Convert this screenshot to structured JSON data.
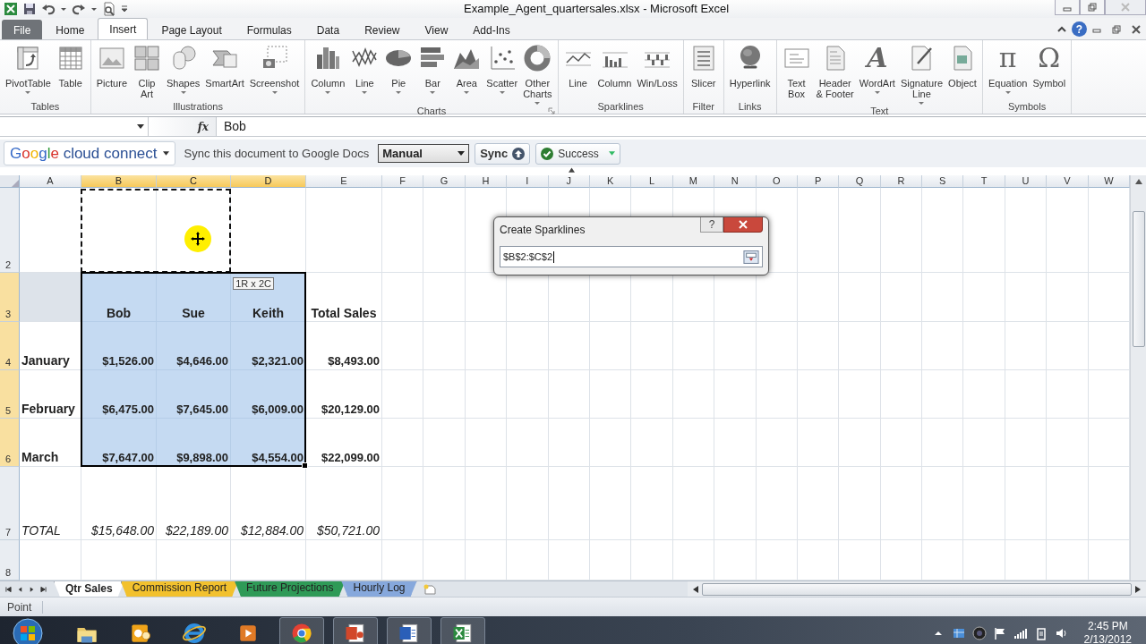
{
  "window": {
    "title": "Example_Agent_quartersales.xlsx - Microsoft Excel"
  },
  "ribbon_tabs": [
    {
      "label": "File",
      "selected": false,
      "kind": "file"
    },
    {
      "label": "Home",
      "selected": false,
      "kind": "tab"
    },
    {
      "label": "Insert",
      "selected": true,
      "kind": "tab"
    },
    {
      "label": "Page Layout",
      "selected": false,
      "kind": "tab"
    },
    {
      "label": "Formulas",
      "selected": false,
      "kind": "tab"
    },
    {
      "label": "Data",
      "selected": false,
      "kind": "tab"
    },
    {
      "label": "Review",
      "selected": false,
      "kind": "tab"
    },
    {
      "label": "View",
      "selected": false,
      "kind": "tab"
    },
    {
      "label": "Add-Ins",
      "selected": false,
      "kind": "tab"
    }
  ],
  "help": "?",
  "ribbon_groups": [
    {
      "label": "Tables",
      "items": [
        {
          "label": "PivotTable",
          "kind": "pivot",
          "dropdown": true
        },
        {
          "label": "Table",
          "kind": "table",
          "dropdown": false
        }
      ]
    },
    {
      "label": "Illustrations",
      "items": [
        {
          "label": "Picture",
          "kind": "picture",
          "dropdown": false
        },
        {
          "label": "Clip\nArt",
          "kind": "clipart",
          "dropdown": false
        },
        {
          "label": "Shapes",
          "kind": "shapes",
          "dropdown": true
        },
        {
          "label": "SmartArt",
          "kind": "smartart",
          "dropdown": false
        },
        {
          "label": "Screenshot",
          "kind": "screenshot",
          "dropdown": true
        }
      ]
    },
    {
      "label": "Charts",
      "launcher": true,
      "items": [
        {
          "label": "Column",
          "kind": "column",
          "dropdown": true
        },
        {
          "label": "Line",
          "kind": "line",
          "dropdown": true
        },
        {
          "label": "Pie",
          "kind": "pie",
          "dropdown": true
        },
        {
          "label": "Bar",
          "kind": "bar",
          "dropdown": true
        },
        {
          "label": "Area",
          "kind": "area",
          "dropdown": true
        },
        {
          "label": "Scatter",
          "kind": "scatter",
          "dropdown": true
        },
        {
          "label": "Other\nCharts",
          "kind": "other",
          "dropdown": true
        }
      ]
    },
    {
      "label": "Sparklines",
      "items": [
        {
          "label": "Line",
          "kind": "spark_line",
          "dropdown": false
        },
        {
          "label": "Column",
          "kind": "spark_column",
          "dropdown": false
        },
        {
          "label": "Win/Loss",
          "kind": "winloss",
          "dropdown": false
        }
      ]
    },
    {
      "label": "Filter",
      "items": [
        {
          "label": "Slicer",
          "kind": "slicer",
          "dropdown": false
        }
      ]
    },
    {
      "label": "Links",
      "items": [
        {
          "label": "Hyperlink",
          "kind": "hyperlink",
          "dropdown": false
        }
      ]
    },
    {
      "label": "Text",
      "items": [
        {
          "label": "Text\nBox",
          "kind": "textbox",
          "dropdown": false
        },
        {
          "label": "Header\n& Footer",
          "kind": "header",
          "dropdown": false
        },
        {
          "label": "WordArt",
          "kind": "wordart",
          "glyph": "A",
          "dropdown": true
        },
        {
          "label": "Signature\nLine",
          "kind": "signature",
          "dropdown": true
        },
        {
          "label": "Object",
          "kind": "object",
          "dropdown": false
        }
      ]
    },
    {
      "label": "Symbols",
      "items": [
        {
          "label": "Equation",
          "kind": "equation",
          "glyph": "π",
          "dropdown": true
        },
        {
          "label": "Symbol",
          "kind": "symbol",
          "glyph": "Ω",
          "dropdown": false
        }
      ]
    }
  ],
  "formula_bar": {
    "fx": "fx",
    "value": "Bob"
  },
  "google_bar": {
    "brand": "Google",
    "product": "cloud connect",
    "message": "Sync this document to Google Docs",
    "mode": "Manual",
    "sync_button": "Sync",
    "status": "Success"
  },
  "columns": [
    {
      "label": "A",
      "selected": false
    },
    {
      "label": "B",
      "selected": true
    },
    {
      "label": "C",
      "selected": true
    },
    {
      "label": "D",
      "selected": true
    },
    {
      "label": "E",
      "selected": false
    },
    {
      "label": "F",
      "selected": false
    },
    {
      "label": "G",
      "selected": false
    },
    {
      "label": "H",
      "selected": false
    },
    {
      "label": "I",
      "selected": false
    },
    {
      "label": "J",
      "selected": false
    },
    {
      "label": "K",
      "selected": false
    },
    {
      "label": "L",
      "selected": false
    },
    {
      "label": "M",
      "selected": false
    },
    {
      "label": "N",
      "selected": false
    },
    {
      "label": "O",
      "selected": false
    },
    {
      "label": "P",
      "selected": false
    },
    {
      "label": "Q",
      "selected": false
    },
    {
      "label": "R",
      "selected": false
    },
    {
      "label": "S",
      "selected": false
    },
    {
      "label": "T",
      "selected": false
    },
    {
      "label": "U",
      "selected": false
    },
    {
      "label": "V",
      "selected": false
    },
    {
      "label": "W",
      "selected": false
    }
  ],
  "rows": [
    {
      "number": "2",
      "selected": false,
      "kind": "blank",
      "cells": [
        {
          "selected": false,
          "marquee": false
        },
        {
          "selected": false,
          "marquee": true
        },
        {
          "selected": false,
          "marquee": true
        },
        {
          "selected": false,
          "marquee": false
        },
        {
          "selected": false,
          "marquee": false
        }
      ]
    },
    {
      "number": "3",
      "selected": true,
      "kind": "header",
      "cells": [
        {
          "selected": false,
          "marquee": false
        },
        {
          "text": "Bob",
          "selected": true,
          "marquee": false
        },
        {
          "text": "Sue",
          "selected": true,
          "marquee": false
        },
        {
          "text": "Keith",
          "selected": true,
          "marquee": false
        },
        {
          "text": "Total Sales",
          "selected": false,
          "marquee": false
        }
      ]
    },
    {
      "number": "4",
      "selected": true,
      "kind": "data",
      "cells": [
        {
          "text": "January",
          "selected": false,
          "marquee": false
        },
        {
          "text": "$1,526.00",
          "selected": true,
          "marquee": false
        },
        {
          "text": "$4,646.00",
          "selected": true,
          "marquee": false
        },
        {
          "text": "$2,321.00",
          "selected": true,
          "marquee": false
        },
        {
          "text": "$8,493.00",
          "selected": false,
          "marquee": false
        }
      ]
    },
    {
      "number": "5",
      "selected": true,
      "kind": "data",
      "cells": [
        {
          "text": "February",
          "selected": false,
          "marquee": false
        },
        {
          "text": "$6,475.00",
          "selected": true,
          "marquee": false
        },
        {
          "text": "$7,645.00",
          "selected": true,
          "marquee": false
        },
        {
          "text": "$6,009.00",
          "selected": true,
          "marquee": false
        },
        {
          "text": "$20,129.00",
          "selected": false,
          "marquee": false
        }
      ]
    },
    {
      "number": "6",
      "selected": true,
      "kind": "data",
      "cells": [
        {
          "text": "March",
          "selected": false,
          "marquee": false
        },
        {
          "text": "$7,647.00",
          "selected": true,
          "marquee": false
        },
        {
          "text": "$9,898.00",
          "selected": true,
          "marquee": false
        },
        {
          "text": "$4,554.00",
          "selected": true,
          "marquee": false
        },
        {
          "text": "$22,099.00",
          "selected": false,
          "marquee": false
        }
      ]
    },
    {
      "number": "7",
      "selected": false,
      "kind": "total",
      "cells": [
        {
          "text": "TOTAL",
          "selected": false,
          "marquee": false
        },
        {
          "text": "$15,648.00",
          "selected": false,
          "marquee": false
        },
        {
          "text": "$22,189.00",
          "selected": false,
          "marquee": false
        },
        {
          "text": "$12,884.00",
          "selected": false,
          "marquee": false
        },
        {
          "text": "$50,721.00",
          "selected": false,
          "marquee": false
        }
      ]
    },
    {
      "number": "8",
      "selected": false,
      "cells": []
    }
  ],
  "size_tooltip": "1R x 2C",
  "dialog": {
    "title": "Create Sparklines",
    "help": "?",
    "value": "$B$2:$C$2"
  },
  "sheet_tabs": [
    {
      "label": "Qtr Sales",
      "selected": true,
      "color": "#ffffff"
    },
    {
      "label": "Commission Report",
      "selected": false,
      "color": "#f2c12e"
    },
    {
      "label": "Future Projections",
      "selected": false,
      "color": "#2f9a57"
    },
    {
      "label": "Hourly Log",
      "selected": false,
      "color": "#86a8dc"
    }
  ],
  "status_bar": {
    "mode": "Point"
  },
  "taskbar": {
    "apps": [
      {
        "kind": "folder",
        "running": false
      },
      {
        "kind": "outlook",
        "running": false
      },
      {
        "kind": "ie",
        "running": false
      },
      {
        "kind": "media",
        "running": false
      },
      {
        "kind": "chrome",
        "running": true
      },
      {
        "kind": "powerpoint",
        "running": true
      },
      {
        "kind": "word",
        "running": true
      },
      {
        "kind": "excel",
        "running": true
      }
    ],
    "time": "2:45 PM",
    "date": "2/13/2012"
  }
}
